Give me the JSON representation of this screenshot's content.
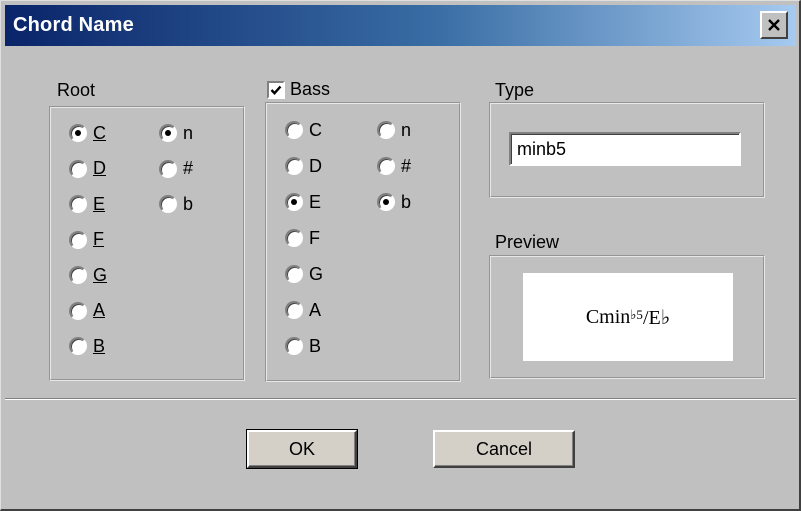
{
  "window": {
    "title": "Chord Name",
    "close_glyph": "✕"
  },
  "root": {
    "label": "Root",
    "notes": [
      {
        "text": "C",
        "checked": true
      },
      {
        "text": "D",
        "checked": false
      },
      {
        "text": "E",
        "checked": false
      },
      {
        "text": "F",
        "checked": false
      },
      {
        "text": "G",
        "checked": false
      },
      {
        "text": "A",
        "checked": false
      },
      {
        "text": "B",
        "checked": false
      }
    ],
    "accidentals": [
      {
        "text": "n",
        "checked": true
      },
      {
        "text": "#",
        "checked": false
      },
      {
        "text": "b",
        "checked": false
      }
    ]
  },
  "bass": {
    "label": "Bass",
    "enabled": true,
    "notes": [
      {
        "text": "C",
        "checked": false
      },
      {
        "text": "D",
        "checked": false
      },
      {
        "text": "E",
        "checked": true
      },
      {
        "text": "F",
        "checked": false
      },
      {
        "text": "G",
        "checked": false
      },
      {
        "text": "A",
        "checked": false
      },
      {
        "text": "B",
        "checked": false
      }
    ],
    "accidentals": [
      {
        "text": "n",
        "checked": false
      },
      {
        "text": "#",
        "checked": false
      },
      {
        "text": "b",
        "checked": true
      }
    ]
  },
  "type": {
    "label": "Type",
    "value": "minb5"
  },
  "preview": {
    "label": "Preview",
    "main": "Cmin",
    "superscript": "♭5",
    "suffix": "/E♭"
  },
  "buttons": {
    "ok": "OK",
    "cancel": "Cancel"
  },
  "icons": {
    "close": "close-icon",
    "check": "checkmark-icon"
  },
  "colors": {
    "title_start": "#0a246a",
    "title_end": "#a6caf0",
    "face": "#c0c0c0"
  }
}
